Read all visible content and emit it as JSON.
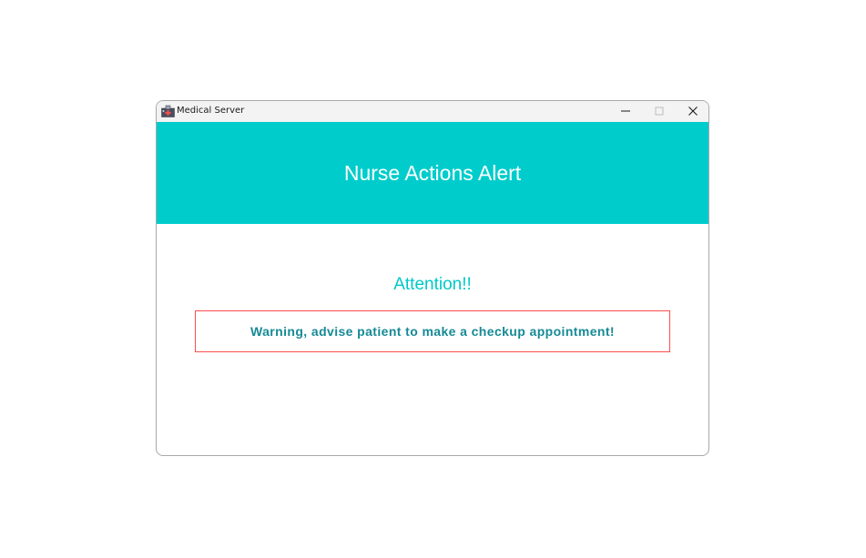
{
  "window": {
    "title": "Medical Server",
    "app_icon": "medical-server-app-icon",
    "controls": {
      "minimize_icon": "minimize-icon",
      "maximize_icon": "maximize-icon",
      "close_icon": "close-icon"
    }
  },
  "header": {
    "title": "Nurse Actions Alert",
    "background_color": "#00CCCC",
    "text_color": "#FFFFFF"
  },
  "alert": {
    "heading": "Attention!!",
    "heading_color": "#00C8C8",
    "message": "Warning, advise patient to make a checkup appointment!",
    "message_color": "#168A96",
    "border_color": "#FF4D4D"
  }
}
